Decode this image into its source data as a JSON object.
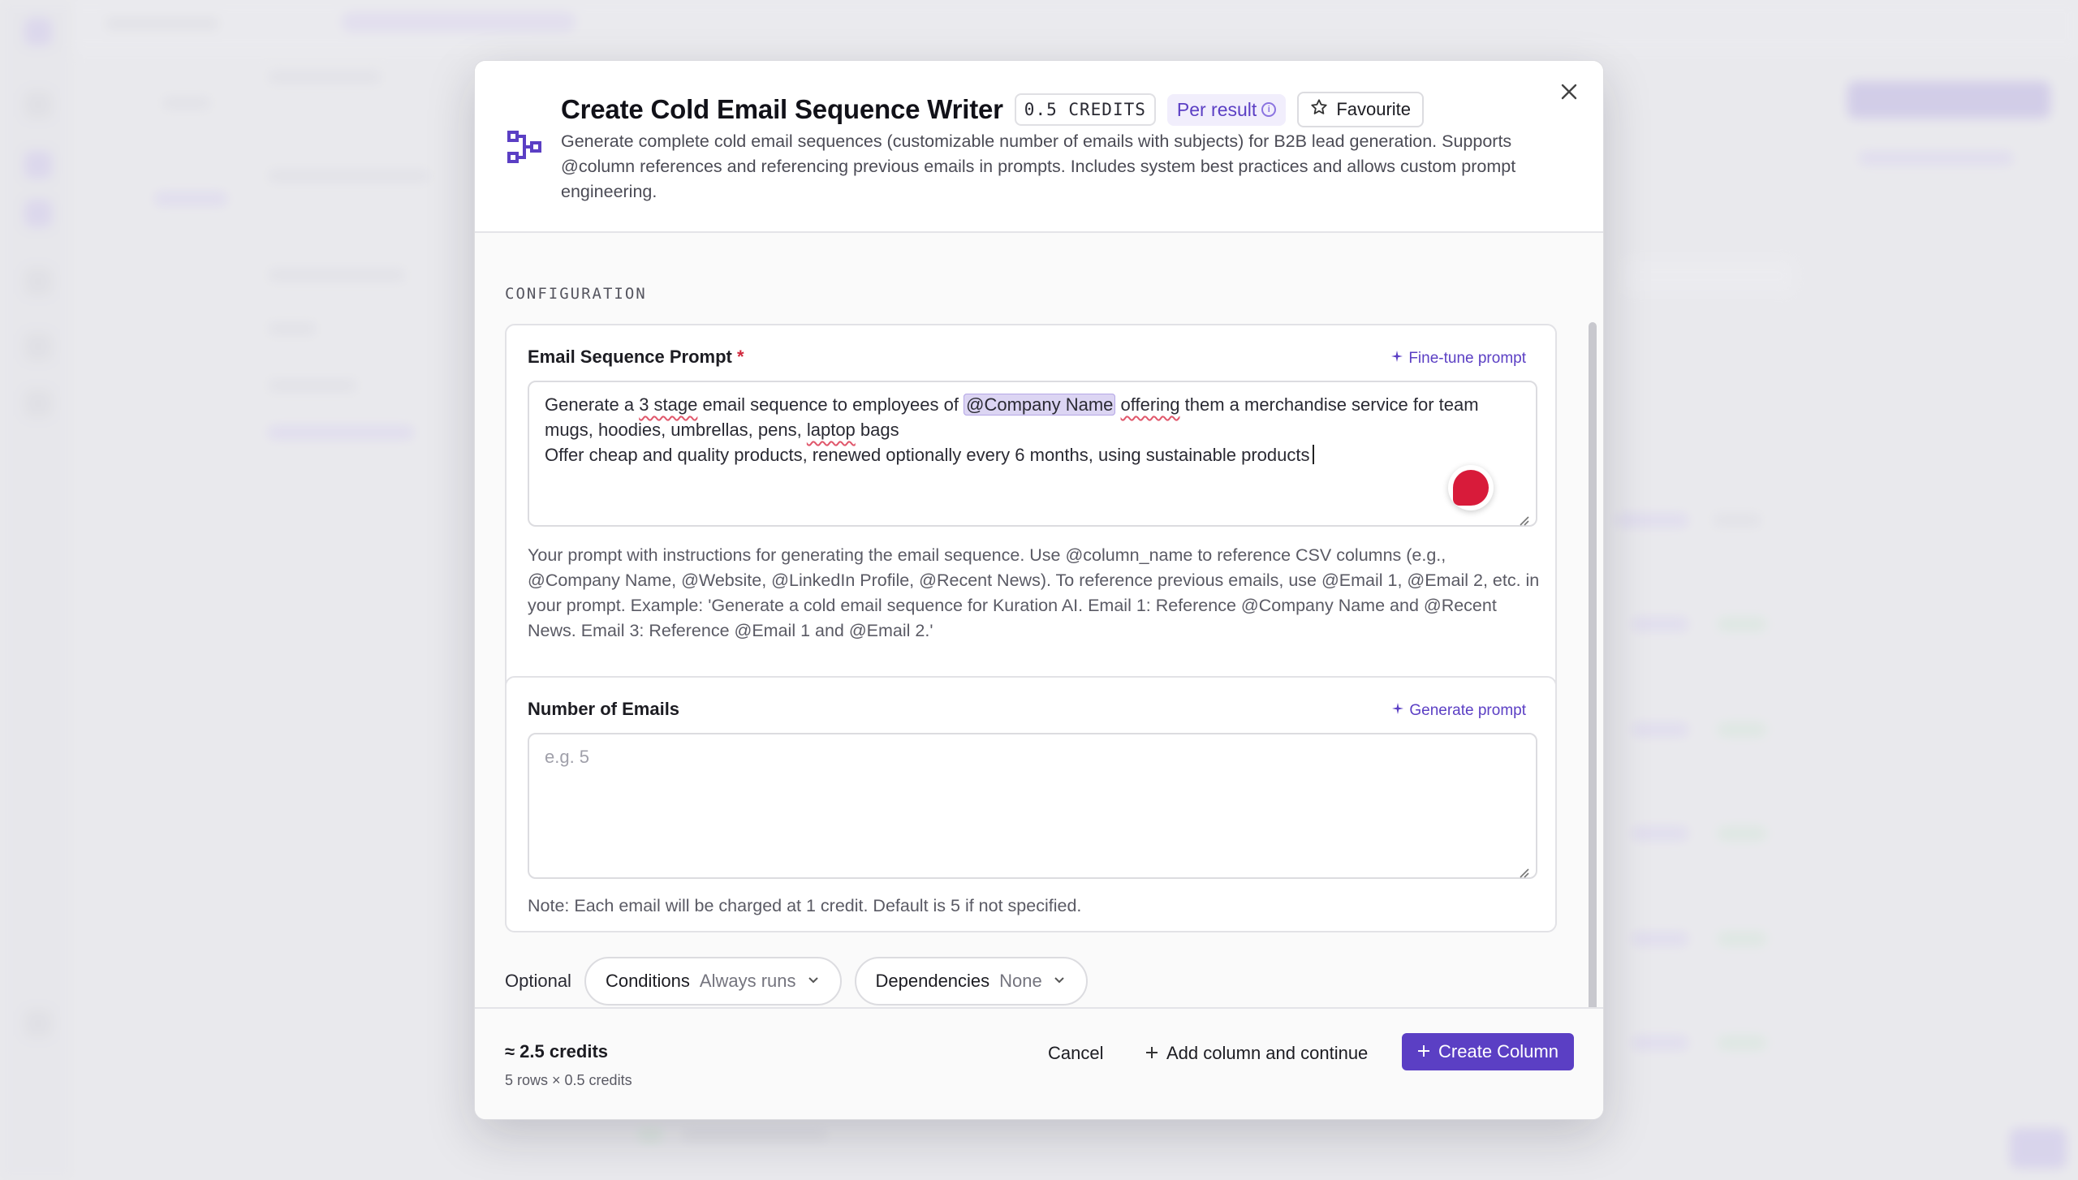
{
  "modal": {
    "title": "Create Cold Email Sequence Writer",
    "credits_badge": "0.5 CREDITS",
    "per_result": "Per result",
    "favourite": "Favourite",
    "description": "Generate complete cold email sequences (customizable number of emails with subjects) for B2B lead generation. Supports @column references and referencing previous emails in prompts. Includes system best practices and allows custom prompt engineering."
  },
  "configuration": {
    "section_label": "CONFIGURATION",
    "prompt_field": {
      "label": "Email Sequence Prompt",
      "required_mark": "*",
      "action": "Fine-tune prompt",
      "value": {
        "line1_a": "Generate a ",
        "line1_b": "3 stage",
        "line1_c": " email sequence to employees of ",
        "mention": "@Company Name",
        "line1_d": " ",
        "line1_e": "offering",
        "line1_f": " them a merchandise service for team mugs, hoodies, umbrellas, pens, ",
        "line1_g": "laptop",
        "line1_h": " bags",
        "line2": "Offer cheap and quality products, renewed optionally every 6 months, using sustainable products"
      },
      "help": "Your prompt with instructions for generating the email sequence. Use @column_name to reference CSV columns (e.g., @Company Name, @Website, @LinkedIn Profile, @Recent News). To reference previous emails, use @Email 1, @Email 2, etc. in your prompt. Example: 'Generate a cold email sequence for Kuration AI. Email 1: Reference @Company Name and @Recent News. Email 3: Reference @Email 1 and @Email 2.'"
    },
    "emails_field": {
      "label": "Number of Emails",
      "action": "Generate prompt",
      "placeholder": "e.g. 5",
      "value": "",
      "note": "Note: Each email will be charged at 1 credit. Default is 5 if not specified."
    }
  },
  "optional": {
    "label": "Optional",
    "conditions_key": "Conditions",
    "conditions_value": "Always runs",
    "dependencies_key": "Dependencies",
    "dependencies_value": "None"
  },
  "footer": {
    "estimate": "≈ 2.5 credits",
    "estimate_detail": "5 rows × 0.5 credits",
    "cancel": "Cancel",
    "add_continue": "Add column and continue",
    "create": "Create Column"
  },
  "colors": {
    "accent": "#5b3fc4",
    "required": "#d0283c",
    "mention_bg": "#dcd5f3"
  },
  "icons": {
    "header": "workflow-icon",
    "info": "info-icon",
    "favourite": "star-icon",
    "close": "close-icon",
    "sparkle": "sparkle-icon",
    "chevron": "chevron-down-icon",
    "plus": "plus-icon",
    "grammar": "grammar-assistant-icon"
  }
}
